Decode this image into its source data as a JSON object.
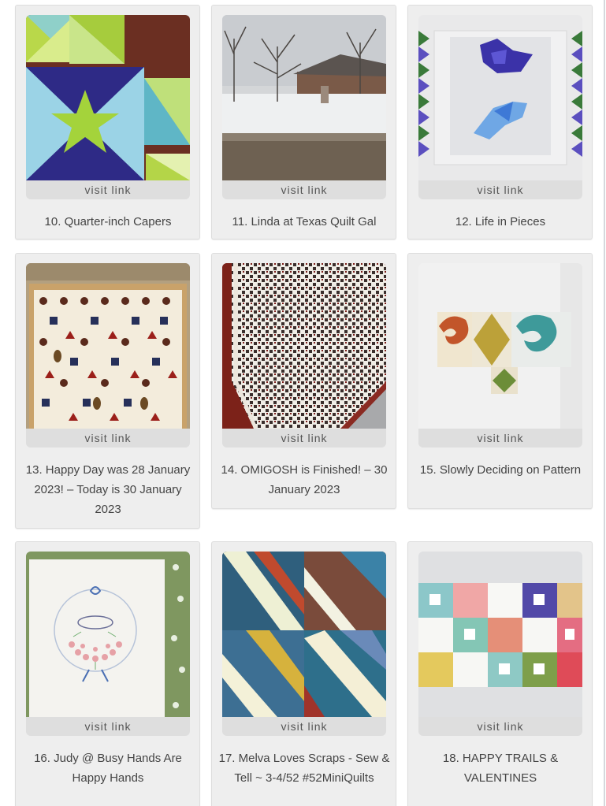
{
  "visit_label": "visit link",
  "items": [
    {
      "title": "10. Quarter-inch Capers",
      "image": "quilt-star-blocks"
    },
    {
      "title": "11. Linda at Texas Quilt Gal",
      "image": "snowy-yard-photo"
    },
    {
      "title": "12. Life in Pieces",
      "image": "bluebird-quilt"
    },
    {
      "title": "13. Happy Day was 28 January 2023! – Today is 30 January 2023",
      "image": "sampler-quilt"
    },
    {
      "title": "14. OMIGOSH is Finished! – 30 January 2023",
      "image": "finished-red-quilt"
    },
    {
      "title": "15. Slowly Deciding on Pattern",
      "image": "swirl-blocks-on-wall"
    },
    {
      "title": "16. Judy @ Busy Hands Are Happy Hands",
      "image": "embroidered-october-wreath"
    },
    {
      "title": "17. Melva Loves Scraps - Sew & Tell ~ 3-4/52 #52MiniQuilts",
      "image": "scrap-string-blocks"
    },
    {
      "title": "18. HAPPY TRAILS & VALENTINES",
      "image": "floral-patchwork-blocks"
    }
  ],
  "colors": {
    "card_bg": "#eeeeee",
    "visit_bg": "#dedede",
    "text": "#444444"
  }
}
